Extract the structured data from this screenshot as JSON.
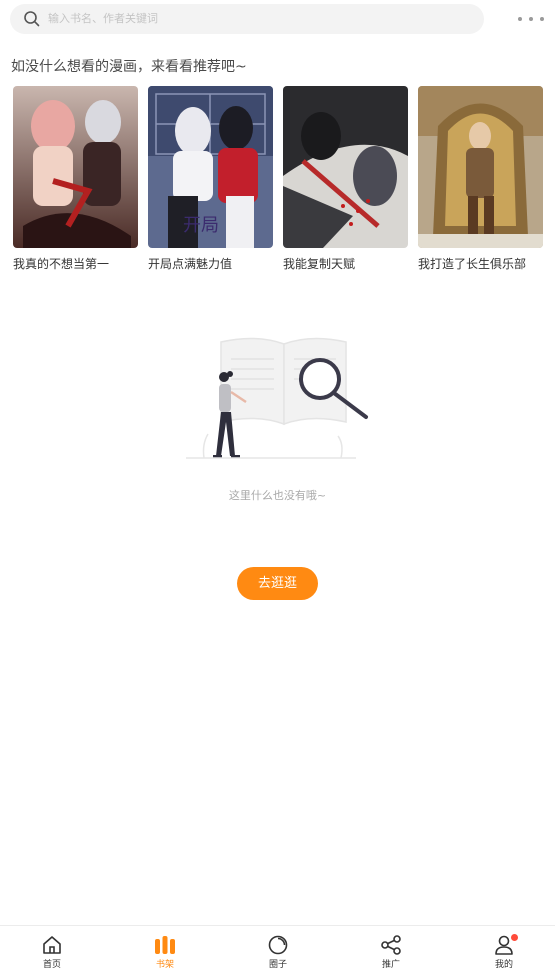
{
  "search": {
    "placeholder": "输入书名、作者关键词",
    "more_icon": "more-dots-icon"
  },
  "recommend": {
    "title": "如没什么想看的漫画，来看看推荐吧~",
    "books": [
      {
        "title": "我真的不想当第一"
      },
      {
        "title": "开局点满魅力值"
      },
      {
        "title": "我能复制天赋"
      },
      {
        "title": "我打造了长生俱乐部"
      }
    ]
  },
  "empty": {
    "text": "这里什么也没有哦~",
    "button": "去逛逛"
  },
  "tabbar": {
    "items": [
      {
        "label": "首页",
        "icon": "home-icon"
      },
      {
        "label": "书架",
        "icon": "bookshelf-icon"
      },
      {
        "label": "圈子",
        "icon": "circle-icon"
      },
      {
        "label": "推广",
        "icon": "share-icon"
      },
      {
        "label": "我的",
        "icon": "user-icon"
      }
    ],
    "active_index": 1
  },
  "colors": {
    "accent": "#ff8a12",
    "badge": "#ff4b3a"
  }
}
